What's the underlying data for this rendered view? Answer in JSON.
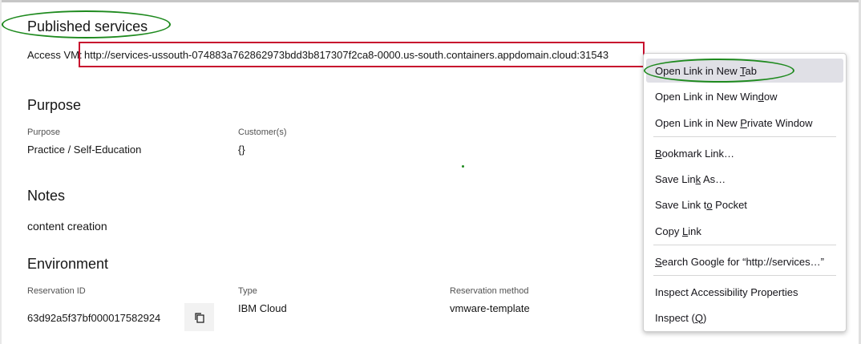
{
  "published": {
    "title": "Published services",
    "access_label": "Access VM:",
    "access_url": "http://services-ussouth-074883a762862973bdd3b817307f2ca8-0000.us-south.containers.appdomain.cloud:31543"
  },
  "purpose": {
    "title": "Purpose",
    "purpose_label": "Purpose",
    "purpose_value": "Practice / Self-Education",
    "customers_label": "Customer(s)",
    "customers_value": "{}"
  },
  "notes": {
    "title": "Notes",
    "value": "content creation"
  },
  "environment": {
    "title": "Environment",
    "reservation_id_label": "Reservation ID",
    "reservation_id_value": "63d92a5f37bf000017582924",
    "type_label": "Type",
    "type_value": "IBM Cloud",
    "method_label": "Reservation method",
    "method_value": "vmware-template"
  },
  "context_menu": {
    "items": [
      {
        "label": "Open Link in New Tab",
        "accel": "T"
      },
      {
        "label": "Open Link in New Window",
        "accel": "d"
      },
      {
        "label": "Open Link in New Private Window",
        "accel": "P"
      },
      {
        "label": "Bookmark Link…",
        "accel": "B"
      },
      {
        "label": "Save Link As…",
        "accel": "k"
      },
      {
        "label": "Save Link to Pocket",
        "accel": "o"
      },
      {
        "label": "Copy Link",
        "accel": "L"
      },
      {
        "label": "Search Google for “http://services…”",
        "accel": "S"
      },
      {
        "label": "Inspect Accessibility Properties",
        "accel": ""
      },
      {
        "label": "Inspect (Q)",
        "accel": "Q"
      }
    ]
  },
  "annotation_colors": {
    "ellipse": "#1e8a1e",
    "box": "#c8102e"
  },
  "icons": {
    "copy": "copy-icon"
  }
}
